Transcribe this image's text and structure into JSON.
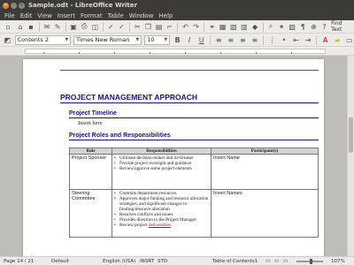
{
  "window": {
    "title": "Sample.odt - LibreOffice Writer"
  },
  "menu": [
    "File",
    "Edit",
    "View",
    "Insert",
    "Format",
    "Table",
    "Window",
    "Help"
  ],
  "toolbar": {
    "find_text": "Find Text"
  },
  "format_bar": {
    "style": "Contents 2",
    "font": "Times New Roman",
    "size": "10"
  },
  "document": {
    "title": "PROJECT MANAGEMENT APPROACH",
    "section1": "Project Timeline",
    "insert_here": "Insert here",
    "section2": "Project Roles and Responsibilities",
    "table": {
      "headers": [
        "Role",
        "Responsibilities",
        "Participant(s)"
      ],
      "rows": [
        {
          "role": "Project Sponsor",
          "responsibilities": [
            "Ultimate decision-maker and tie-breaker",
            "Provide project oversight and guidance",
            "Review/approve some project elements"
          ],
          "participants": "Insert Name"
        },
        {
          "role": "Steering Committee",
          "responsibilities": [
            "Commits department resources",
            "Approves major funding and resource allocation strategies, and significant changes to funding/resource allocation",
            "Resolves conflicts and issues",
            "Provides direction to the Project Manager"
          ],
          "last_item_prefix": "Review project ",
          "last_item_link": "deliverables",
          "last_item_suffix": ".",
          "participants": "Insert Names"
        }
      ]
    }
  },
  "status": {
    "page": "Page 14 / 21",
    "style": "Default",
    "language": "English (USA)",
    "insert": "INSRT",
    "std": "STD",
    "context": "Table of Contents1",
    "zoom": "107%"
  }
}
